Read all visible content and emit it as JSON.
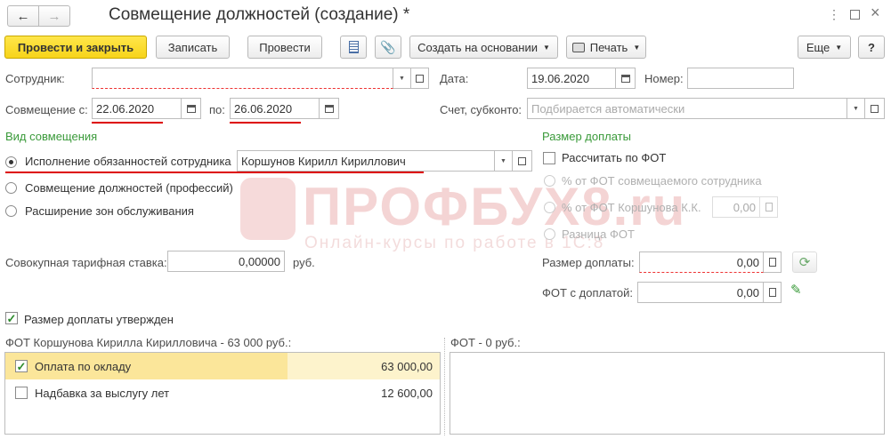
{
  "window": {
    "title": "Совмещение должностей (создание) *",
    "menu_icon": "more-icon",
    "maximize_icon": "maximize-icon",
    "close_icon": "close-icon"
  },
  "toolbar": {
    "post_close_label": "Провести и закрыть",
    "save_label": "Записать",
    "post_label": "Провести",
    "create_based_label": "Создать на основании",
    "print_label": "Печать",
    "more_label": "Еще",
    "help_label": "?"
  },
  "header": {
    "employee_label": "Сотрудник:",
    "employee_value": "",
    "date_label": "Дата:",
    "date_value": "19.06.2020",
    "number_label": "Номер:",
    "number_value": "",
    "from_label": "Совмещение с:",
    "from_value": "22.06.2020",
    "to_label": "по:",
    "to_value": "26.06.2020",
    "account_label": "Счет, субконто:",
    "account_placeholder": "Подбирается автоматически"
  },
  "combination_type": {
    "title": "Вид совмещения",
    "options": [
      {
        "label": "Исполнение обязанностей сотрудника",
        "selected": true
      },
      {
        "label": "Совмещение должностей (профессий)",
        "selected": false
      },
      {
        "label": "Расширение зон обслуживания",
        "selected": false
      }
    ],
    "employee_value": "Коршунов Кирилл Кириллович"
  },
  "rate": {
    "label": "Совокупная тарифная ставка:",
    "value": "0,00000",
    "unit": "руб."
  },
  "surcharge": {
    "title": "Размер доплаты",
    "calc_fot_label": "Рассчитать по ФОТ",
    "calc_fot_checked": false,
    "options": [
      {
        "label": "% от ФОТ совмещаемого сотрудника"
      },
      {
        "label": "% от ФОТ Коршунова К.К."
      },
      {
        "label": "Разница ФОТ"
      }
    ],
    "percent_value": "0,00",
    "amount_label": "Размер доплаты:",
    "amount_value": "0,00",
    "fot_label": "ФОТ с доплатой:",
    "fot_value": "0,00"
  },
  "approved": {
    "label": "Размер доплаты утвержден",
    "checked": true
  },
  "left_table": {
    "title": "ФОТ Коршунова Кирилла Кирилловича - 63 000 руб.:",
    "rows": [
      {
        "name": "Оплата по окладу",
        "amount": "63 000,00",
        "checked": true
      },
      {
        "name": "Надбавка за выслугу лет",
        "amount": "12 600,00",
        "checked": false
      }
    ]
  },
  "right_table": {
    "title": "ФОТ  - 0 руб.:"
  },
  "watermark": {
    "brand": "ПРОФБУХ8.ru",
    "tagline": "Онлайн-курсы по работе в 1С:8"
  },
  "colors": {
    "primary_button": "#f7d41a",
    "section_title": "#3a9a3a",
    "underline": "#d00000",
    "selected_row": "#fbeeb0"
  }
}
